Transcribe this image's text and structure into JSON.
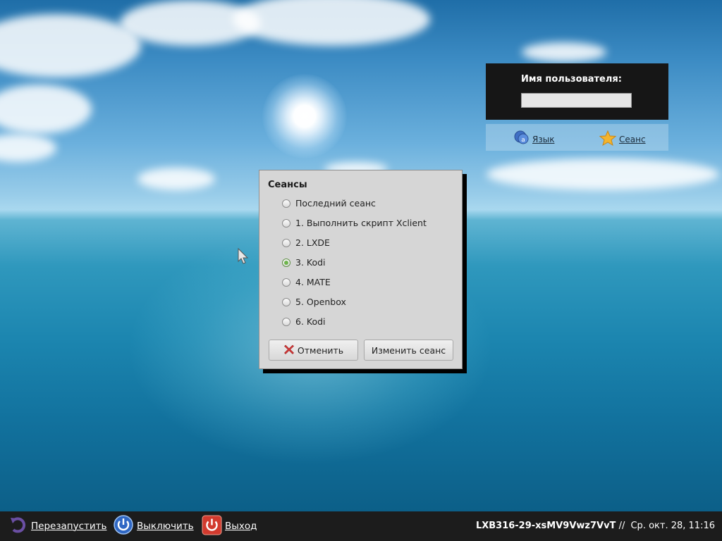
{
  "login": {
    "username_label": "Имя пользователя:",
    "username_value": "",
    "language_button": "Язык",
    "session_button": "Сеанс"
  },
  "sessions_dialog": {
    "title": "Сеансы",
    "options": [
      {
        "label": "Последний сеанс",
        "selected": false
      },
      {
        "label": "1. Выполнить скрипт Xclient",
        "selected": false
      },
      {
        "label": "2. LXDE",
        "selected": false
      },
      {
        "label": "3. Kodi",
        "selected": true
      },
      {
        "label": "4. MATE",
        "selected": false
      },
      {
        "label": "5. Openbox",
        "selected": false
      },
      {
        "label": "6. Kodi",
        "selected": false
      }
    ],
    "cancel_label": "Отменить",
    "change_label": "Изменить сеанс"
  },
  "panel": {
    "restart_label": "Перезапустить",
    "shutdown_label": "Выключить",
    "logout_label": "Выход",
    "hostname": "LXB316-29-xsMV9Vwz7VvT",
    "separator": "//",
    "datetime": "Ср. окт. 28, 11:16"
  },
  "colors": {
    "panel_bg": "#1c1c1c",
    "login_box_bg": "#161616",
    "dialog_bg": "#d6d6d6",
    "selected_radio": "#6eb54c"
  },
  "icons": {
    "language": "speech-bubble-icon",
    "session": "star-icon",
    "cancel": "red-x-icon",
    "restart": "restart-arrow-icon",
    "shutdown": "power-icon",
    "logout": "logout-power-icon",
    "cursor": "mouse-pointer-icon"
  }
}
